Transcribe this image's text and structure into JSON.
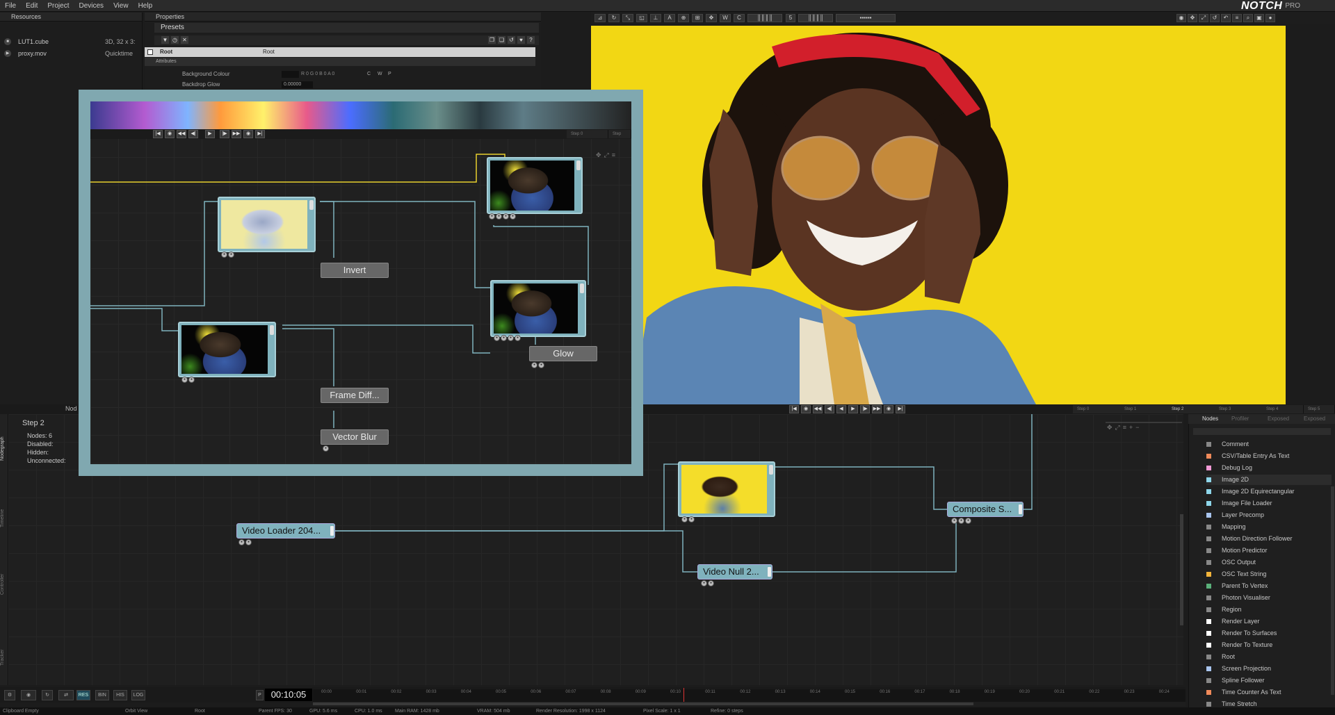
{
  "menu": [
    "File",
    "Edit",
    "Project",
    "Devices",
    "View",
    "Help"
  ],
  "brand": {
    "logo": "NOTCH",
    "edition": "PRO"
  },
  "resources": {
    "title": "Resources",
    "items": [
      {
        "name": "LUT1.cube",
        "info": "3D, 32 x 3:"
      },
      {
        "name": "proxy.mov",
        "info": "Quicktime"
      }
    ]
  },
  "properties": {
    "title": "Properties",
    "presets": "Presets",
    "root_label": "Root",
    "root_value": "Root",
    "attributes": "Attributes",
    "rows": [
      {
        "label": "Background Colour",
        "value": "",
        "extra": "R 0 G 0 B 0 A 0"
      },
      {
        "label": "Backdrop Glow",
        "value": "0.00000",
        "extra": ""
      }
    ],
    "swatch_buttons": [
      "C",
      "W",
      "P"
    ]
  },
  "viewport": {
    "toolbar_number": "5",
    "image_desc_color": "#f2d714"
  },
  "transport": {
    "step_tabs": [
      "Step 0",
      "Step 1",
      "Step 2",
      "Step 3",
      "Step 4",
      "Step 5"
    ],
    "active_step": "Step 2"
  },
  "nodegraph": {
    "tab_label": "Nod",
    "step": {
      "title": "Step 2",
      "nodes": "Nodes:  6",
      "disabled": "Disabled:",
      "hidden": "Hidden:",
      "unconnected": "Unconnected:"
    },
    "side_tabs": [
      "Nodegraph",
      "Timeline",
      "Controller",
      "Tracker"
    ],
    "nodes": {
      "video_loader": "Video Loader 204...",
      "video_null": "Video Null 2...",
      "composite": "Composite S..."
    }
  },
  "popup": {
    "nodes": {
      "invert": "Invert",
      "glow": "Glow",
      "frame_diff": "Frame Diff...",
      "vector_blur": "Vector Blur"
    },
    "step_tabs": [
      "Step 0",
      "Step"
    ]
  },
  "nodes_panel": {
    "tabs": [
      "Nodes",
      "Profiler",
      "Exposed",
      "Exposed"
    ],
    "items": [
      {
        "label": "Comment",
        "color": "#888888"
      },
      {
        "label": "CSV/Table Entry As Text",
        "color": "#f08a5a"
      },
      {
        "label": "Debug Log",
        "color": "#f29ad6"
      },
      {
        "label": "Image 2D",
        "color": "#8ed6ea",
        "selected": true
      },
      {
        "label": "Image 2D Equirectangular",
        "color": "#8ed6ea"
      },
      {
        "label": "Image File Loader",
        "color": "#8ed6ea"
      },
      {
        "label": "Layer Precomp",
        "color": "#a9c5ee"
      },
      {
        "label": "Mapping",
        "color": "#888888"
      },
      {
        "label": "Motion Direction Follower",
        "color": "#888888"
      },
      {
        "label": "Motion Predictor",
        "color": "#888888"
      },
      {
        "label": "OSC Output",
        "color": "#888888"
      },
      {
        "label": "OSC Text String",
        "color": "#f3b43a"
      },
      {
        "label": "Parent To Vertex",
        "color": "#5ab07a"
      },
      {
        "label": "Photon Visualiser",
        "color": "#888888"
      },
      {
        "label": "Region",
        "color": "#888888"
      },
      {
        "label": "Render Layer",
        "color": "#ffffff"
      },
      {
        "label": "Render To Surfaces",
        "color": "#ffffff"
      },
      {
        "label": "Render To Texture",
        "color": "#ffffff"
      },
      {
        "label": "Root",
        "color": "#888888"
      },
      {
        "label": "Screen Projection",
        "color": "#a9c5ee"
      },
      {
        "label": "Spline Follower",
        "color": "#888888"
      },
      {
        "label": "Time Counter As Text",
        "color": "#f08a5a"
      },
      {
        "label": "Time Stretch",
        "color": "#888888"
      }
    ]
  },
  "bottom": {
    "buttons": [
      "RES",
      "BIN",
      "HIS",
      "LOG"
    ],
    "play_label": "P",
    "timecode": "00:10:05",
    "ruler": [
      "00:00",
      "00:01",
      "00:02",
      "00:03",
      "00:04",
      "00:05",
      "00:06",
      "00:07",
      "00:08",
      "00:09",
      "00:10",
      "00:11",
      "00:12",
      "00:13",
      "00:14",
      "00:15",
      "00:16",
      "00:17",
      "00:18",
      "00:19",
      "00:20",
      "00:21",
      "00:22",
      "00:23",
      "00:24"
    ]
  },
  "status": {
    "clipboard": "Clipboard Empty",
    "view": "Orbit View",
    "root": "Root",
    "fps": "Parent FPS: 30",
    "gpu": "GPU: 5.6 ms",
    "cpu": "CPU: 1.0 ms",
    "ram": "Main RAM: 1428 mb",
    "vram": "VRAM: 504 mb",
    "resolution": "Render Resolution: 1998 x 1124",
    "pixel_scale": "Pixel Scale: 1 x 1",
    "refine": "Refine: 0 steps"
  }
}
